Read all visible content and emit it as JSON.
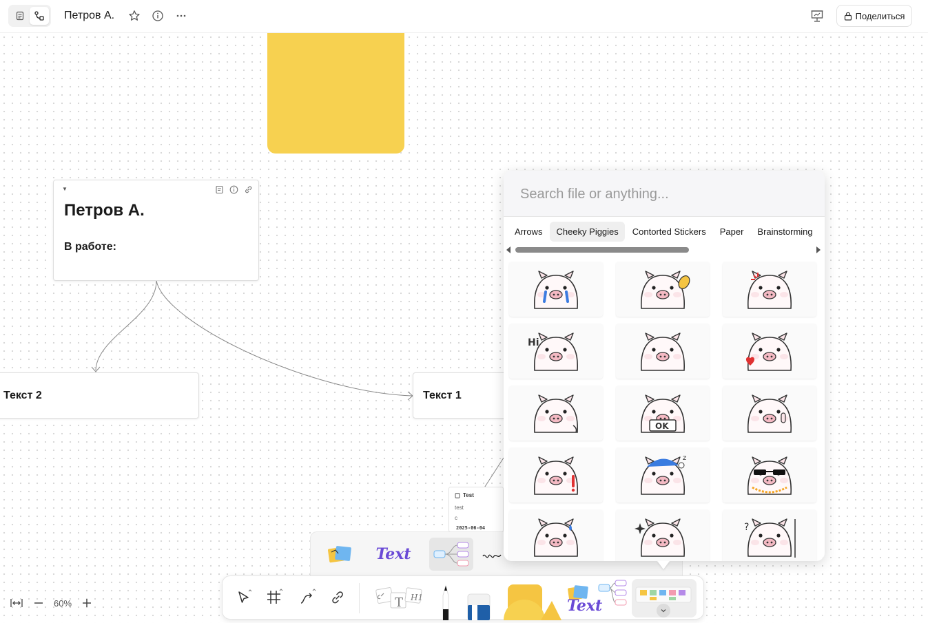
{
  "header": {
    "title": "Петров А.",
    "share_label": "Поделиться"
  },
  "canvas": {
    "note_title": "Петров А.",
    "note_subheading": "В работе:",
    "nodes": [
      "Текст 2",
      "Текст 1"
    ],
    "mini_card": {
      "title": "Test",
      "line1": "test",
      "line2": "c",
      "date": "2025-06-04"
    }
  },
  "panel": {
    "search_placeholder": "Search file or anything...",
    "tabs": [
      "Arrows",
      "Cheeky Piggies",
      "Contorted Stickers",
      "Paper",
      "Brainstorming"
    ],
    "active_tab": "Cheeky Piggies",
    "stickers": [
      "crying-pig",
      "pig-with-bread",
      "angry-pig",
      "hi-pig",
      "worried-pig",
      "heart-wink-pig",
      "sad-pig",
      "ok-sign-pig",
      "middle-finger-pig",
      "shocked-pig",
      "sleepy-cap-pig",
      "cool-sunglasses-pig",
      "sweat-pig",
      "sparkle-pig",
      "question-pig"
    ]
  },
  "flyout": {
    "text_label": "Text"
  },
  "toolbar": {
    "text_label": "Text",
    "shape_tool_text": "T",
    "shape_tool_h1": "H1"
  },
  "zoom": {
    "level": "60%"
  },
  "colors": {
    "sticky_yellow": "#f7d150",
    "accent_purple": "#6a4ad6",
    "pig_pink": "#fbe4e8",
    "pig_nose": "#f4b9c3"
  }
}
